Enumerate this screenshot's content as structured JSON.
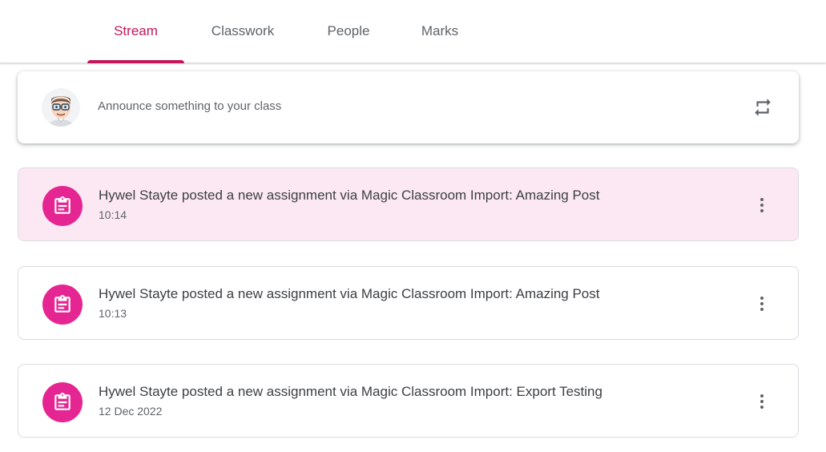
{
  "tabs": [
    {
      "label": "Stream",
      "active": true
    },
    {
      "label": "Classwork",
      "active": false
    },
    {
      "label": "People",
      "active": false
    },
    {
      "label": "Marks",
      "active": false
    }
  ],
  "composer": {
    "placeholder": "Announce something to your class",
    "repost_icon": "repost-icon"
  },
  "posts": [
    {
      "title": "Hywel Stayte posted a new assignment via Magic Classroom Import: Amazing Post",
      "time": "10:14",
      "highlighted": true,
      "icon": "assignment-icon"
    },
    {
      "title": "Hywel Stayte posted a new assignment via Magic Classroom Import: Amazing Post",
      "time": "10:13",
      "highlighted": false,
      "icon": "assignment-icon"
    },
    {
      "title": "Hywel Stayte posted a new assignment via Magic Classroom Import: Export Testing",
      "time": "12 Dec 2022",
      "highlighted": false,
      "icon": "assignment-icon"
    }
  ],
  "colors": {
    "accent": "#c2185b",
    "assignment_badge": "#e52592",
    "highlight_bg": "#fce8f3"
  }
}
